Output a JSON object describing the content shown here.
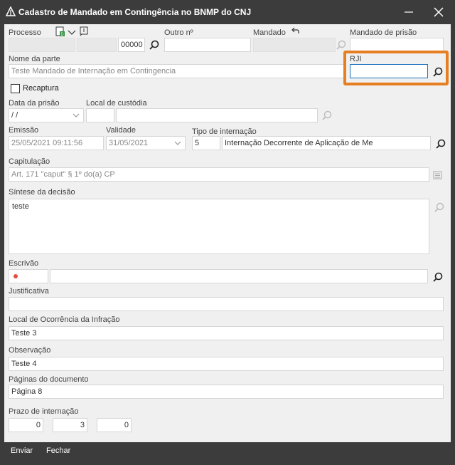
{
  "window": {
    "title": "Cadastro de Mandado em Contingência no BNMP do CNJ",
    "minimize_icon": "minimize-icon",
    "close_icon": "close-icon"
  },
  "form": {
    "processo": {
      "label": "Processo",
      "seq_value": "00000"
    },
    "outro_numero": {
      "label": "Outro nº",
      "value": ""
    },
    "mandado": {
      "label": "Mandado",
      "value": ""
    },
    "mandado_prisao": {
      "label": "Mandado de prisão",
      "value": ""
    },
    "nome_parte": {
      "label": "Nome da parte",
      "value": "Teste Mandado de Internação em Contingencia"
    },
    "rji": {
      "label": "RJI",
      "value": ""
    },
    "recaptura": {
      "label": "Recaptura",
      "checked": false
    },
    "data_prisao": {
      "label": "Data da prisão",
      "value": " /  /"
    },
    "local_custodia": {
      "label": "Local de custódia",
      "value": ""
    },
    "emissao": {
      "label": "Emissão",
      "value": "25/05/2021 09:11:56"
    },
    "validade": {
      "label": "Validade",
      "value": "31/05/2021"
    },
    "tipo_internacao": {
      "label": "Tipo de internação",
      "code": "5",
      "desc": "Internação Decorrente de Aplicação de Me"
    },
    "capitulacao": {
      "label": "Capitulação",
      "value": "Art. 171 \"caput\" § 1º do(a) CP"
    },
    "sintese": {
      "label": "Síntese da decisão",
      "value": "teste"
    },
    "escrivao": {
      "label": "Escrivão",
      "value": ""
    },
    "justificativa": {
      "label": "Justificativa",
      "value": ""
    },
    "local_ocorrencia": {
      "label": "Local de Ocorrência da Infração",
      "value": "Teste 3"
    },
    "observacao": {
      "label": "Observação",
      "value": "Teste 4"
    },
    "paginas": {
      "label": "Páginas do documento",
      "value": "Página 8"
    },
    "prazo": {
      "label": "Prazo de internação",
      "values": [
        "0",
        "3",
        "0"
      ]
    }
  },
  "footer": {
    "enviar_label": "Enviar",
    "fechar_label": "Fechar"
  },
  "colors": {
    "highlight": "#e67e22",
    "titlebar": "#3c3c3c",
    "form_bg": "#f0f0f0",
    "required_dot": "#e84c3d"
  }
}
